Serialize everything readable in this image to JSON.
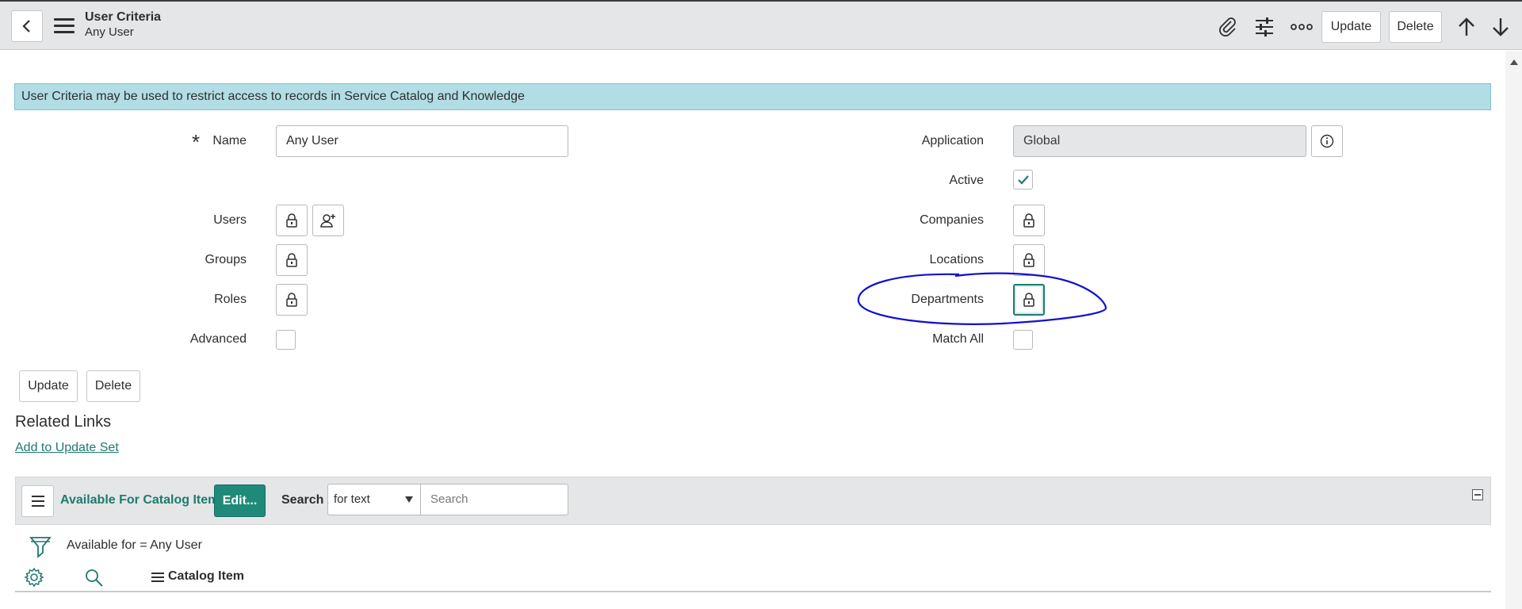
{
  "header": {
    "title": "User Criteria",
    "subtitle": "Any User",
    "update_label": "Update",
    "delete_label": "Delete",
    "icons": [
      "back-icon",
      "menu-icon",
      "paperclip-icon",
      "sliders-icon",
      "more-icon",
      "arrow-up-icon",
      "arrow-down-icon"
    ]
  },
  "banner": {
    "text": "User Criteria may be used to restrict access to records in Service Catalog and Knowledge"
  },
  "form": {
    "name_label": "Name",
    "name_value": "Any User",
    "application_label": "Application",
    "application_value": "Global",
    "active_label": "Active",
    "active_checked": true,
    "users_label": "Users",
    "companies_label": "Companies",
    "groups_label": "Groups",
    "locations_label": "Locations",
    "roles_label": "Roles",
    "departments_label": "Departments",
    "advanced_label": "Advanced",
    "advanced_checked": false,
    "match_all_label": "Match All",
    "match_all_checked": false
  },
  "actions": {
    "update_label": "Update",
    "delete_label": "Delete"
  },
  "related_links": {
    "heading": "Related Links",
    "link_label": "Add to Update Set"
  },
  "related_list": {
    "title": "Available For Catalog Items",
    "edit_label": "Edit...",
    "search_label": "Search",
    "search_select_value": "for text",
    "search_placeholder": "Search",
    "filter_text": "Available for = Any User",
    "column_header": "Catalog Item"
  },
  "colors": {
    "accent": "#1f7a6f",
    "banner_bg": "#b2dde4",
    "header_bg": "#e4e6e7",
    "annotation": "#1010d0"
  }
}
